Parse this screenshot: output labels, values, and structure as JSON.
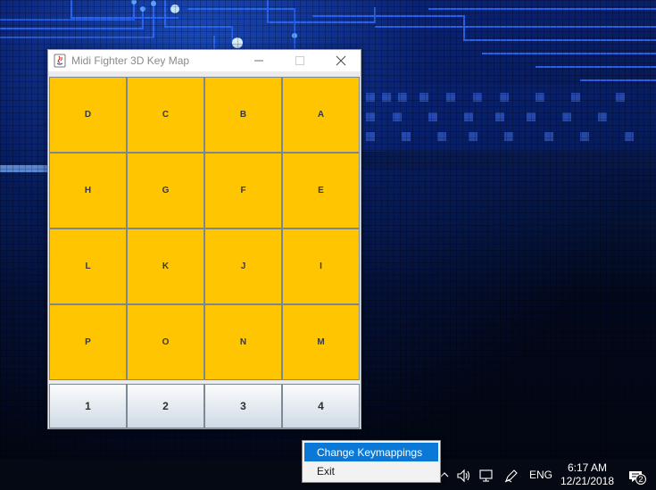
{
  "window": {
    "title": "Midi Fighter 3D Key Map"
  },
  "key_grid": {
    "rows": [
      [
        "D",
        "C",
        "B",
        "A"
      ],
      [
        "H",
        "G",
        "F",
        "E"
      ],
      [
        "L",
        "K",
        "J",
        "I"
      ],
      [
        "P",
        "O",
        "N",
        "M"
      ]
    ]
  },
  "banks": [
    "1",
    "2",
    "3",
    "4"
  ],
  "context_menu": {
    "items": [
      "Change Keymappings",
      "Exit"
    ]
  },
  "taskbar": {
    "language": "ENG",
    "time": "6:17 AM",
    "date": "12/21/2018",
    "notification_count": "2"
  },
  "colors": {
    "key_fill": "#ffc500",
    "key_border": "#7d8790",
    "menu_highlight": "#0a78d7"
  },
  "icons": [
    "java-app-icon",
    "minimize-icon",
    "maximize-icon",
    "close-icon",
    "tray-chevron-icon",
    "volume-icon",
    "network-icon",
    "pen-icon",
    "action-center-icon"
  ]
}
